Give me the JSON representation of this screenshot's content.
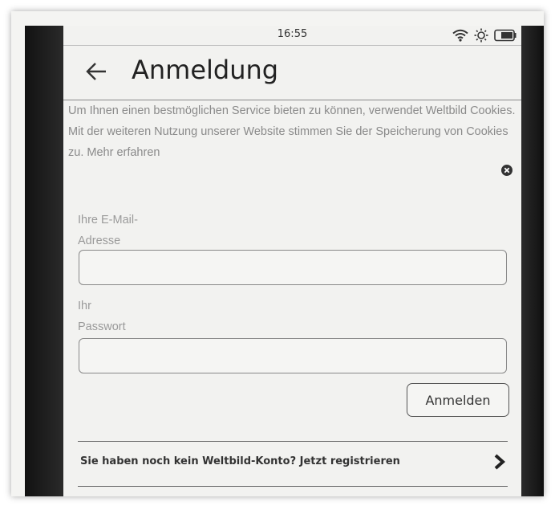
{
  "status_bar": {
    "time": "16:55",
    "icons": [
      "wifi-icon",
      "brightness-icon",
      "battery-icon"
    ]
  },
  "header": {
    "back_icon": "arrow-left-icon",
    "title": "Anmeldung"
  },
  "cookie_notice": {
    "text": "Um Ihnen einen bestmöglichen Service bieten zu können, verwendet Weltbild Cookies. Mit der weiteren Nutzung unserer Website stimmen Sie der Speicherung von Cookies zu.",
    "more_link": "Mehr erfahren",
    "close_icon": "close-icon"
  },
  "form": {
    "email_label_line1": "Ihre E-Mail-",
    "email_label_line2": "Adresse",
    "email_value": "",
    "password_label_line1": "Ihr",
    "password_label_line2": "Passwort",
    "password_value": "",
    "submit_label": "Anmelden"
  },
  "register": {
    "text": "Sie haben noch kein Weltbild-Konto? Jetzt registrieren",
    "icon": "chevron-right-icon"
  },
  "colors": {
    "screen_background": "#f2f2f0",
    "text_primary": "#222222",
    "text_muted": "#8a8a8a",
    "bezel": "#1a1a1a"
  }
}
